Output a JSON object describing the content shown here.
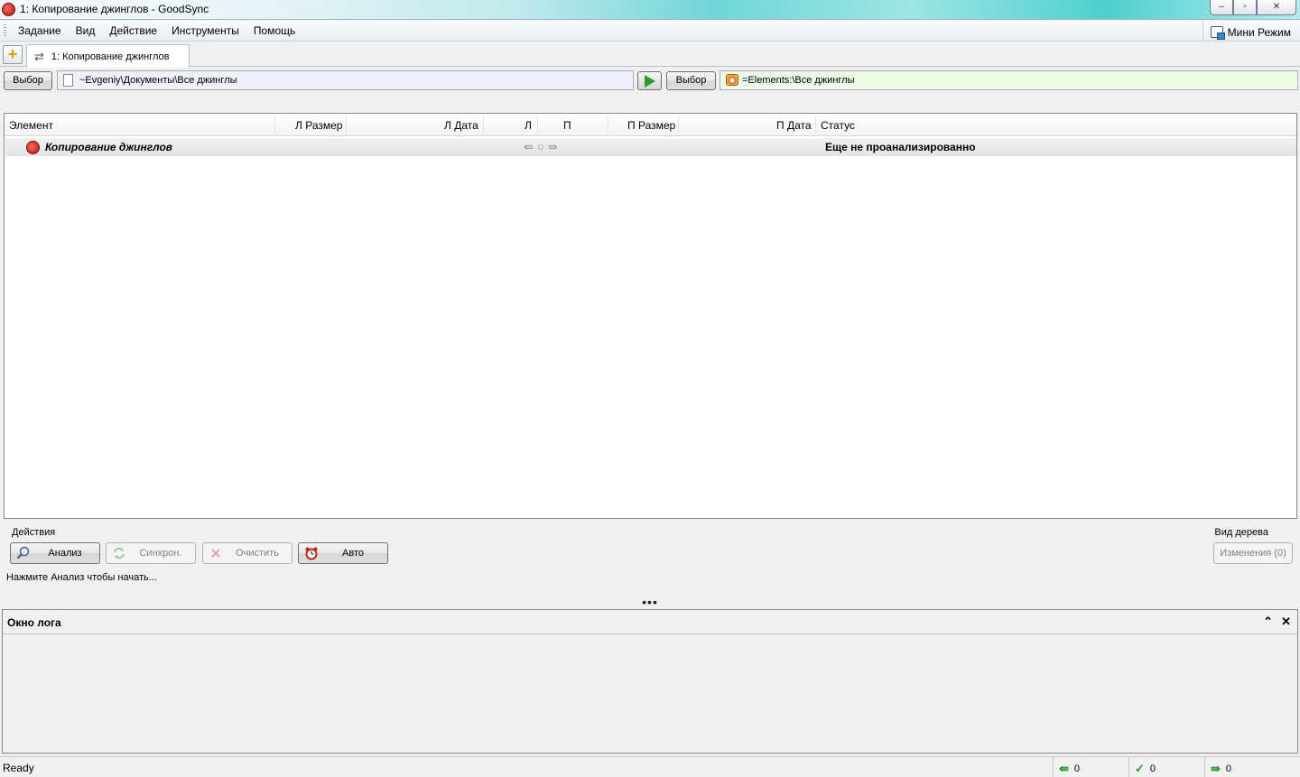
{
  "window": {
    "title": "1: Копирование джинглов - GoodSync",
    "minimize": "–",
    "maximize": "▫",
    "close": "✕"
  },
  "menu": {
    "items": [
      "Задание",
      "Вид",
      "Действие",
      "Инструменты",
      "Помощь"
    ],
    "mini_mode": "Мини Режим"
  },
  "tabs": {
    "add": "+",
    "active_tab": "1: Копирование джинглов"
  },
  "paths": {
    "left_browse": "Выбор",
    "left_path": "~Evgeniy\\Документы\\Все джинглы",
    "right_browse": "Выбор",
    "right_path": "=Elements:\\Все джинглы"
  },
  "list": {
    "columns": [
      "Элемент",
      "Л Размер",
      "Л Дата",
      "Л",
      "П",
      "П Размер",
      "П Дата",
      "Статус"
    ],
    "rows": [
      {
        "name": "Копирование джинглов",
        "arrows": [
          "⇚",
          "○",
          "⇛"
        ],
        "status": "Еще не проанализированно"
      }
    ]
  },
  "actions": {
    "group_label": "Действия",
    "analyze": "Анализ",
    "sync": "Синхрон.",
    "clean": "Очистить",
    "auto": "Авто",
    "hint": "Нажмите Анализ чтобы начать...",
    "tree_label": "Вид дерева",
    "tree_button": "Изменения (0)",
    "splitter": "•••"
  },
  "log": {
    "title": "Окно лога",
    "collapse": "⌃",
    "close": "✕"
  },
  "status": {
    "text": "Ready",
    "left_count": "0",
    "ok_count": "0",
    "right_count": "0"
  }
}
